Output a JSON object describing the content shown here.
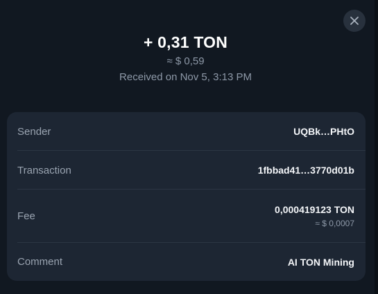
{
  "transaction": {
    "amount": "+ 0,31 TON",
    "fiat_amount": "≈ $ 0,59",
    "date_text": "Received on Nov 5, 3:13 PM"
  },
  "details": {
    "sender": {
      "label": "Sender",
      "value": "UQBk…PHtO"
    },
    "transaction": {
      "label": "Transaction",
      "value": "1fbbad41…3770d01b"
    },
    "fee": {
      "label": "Fee",
      "value": "0,000419123 TON",
      "fiat": "≈ $ 0,0007"
    },
    "comment": {
      "label": "Comment",
      "value": "AI TON Mining"
    }
  },
  "icons": {
    "close": "close-icon"
  },
  "colors": {
    "background": "#111821",
    "card": "#1d2633",
    "divider": "#2c3644",
    "primary_text": "#ffffff",
    "secondary_text": "#8e99a8",
    "close_button": "#28313d"
  }
}
